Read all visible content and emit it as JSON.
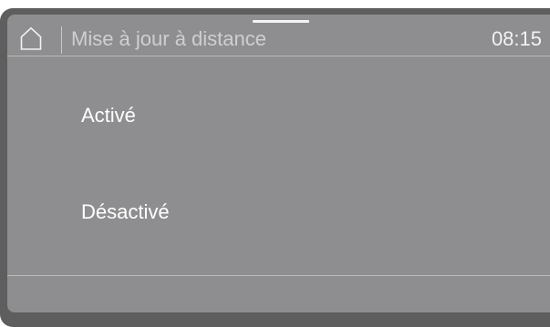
{
  "header": {
    "home_icon": "home-icon",
    "title": "Mise à jour à distance",
    "time": "08:15"
  },
  "options": [
    {
      "label": "Activé"
    },
    {
      "label": "Désactivé"
    }
  ],
  "colors": {
    "bezel": "#5e5e5e",
    "screen": "#8e8e90",
    "title_text": "#cfcfcf",
    "option_text": "#ffffff"
  }
}
